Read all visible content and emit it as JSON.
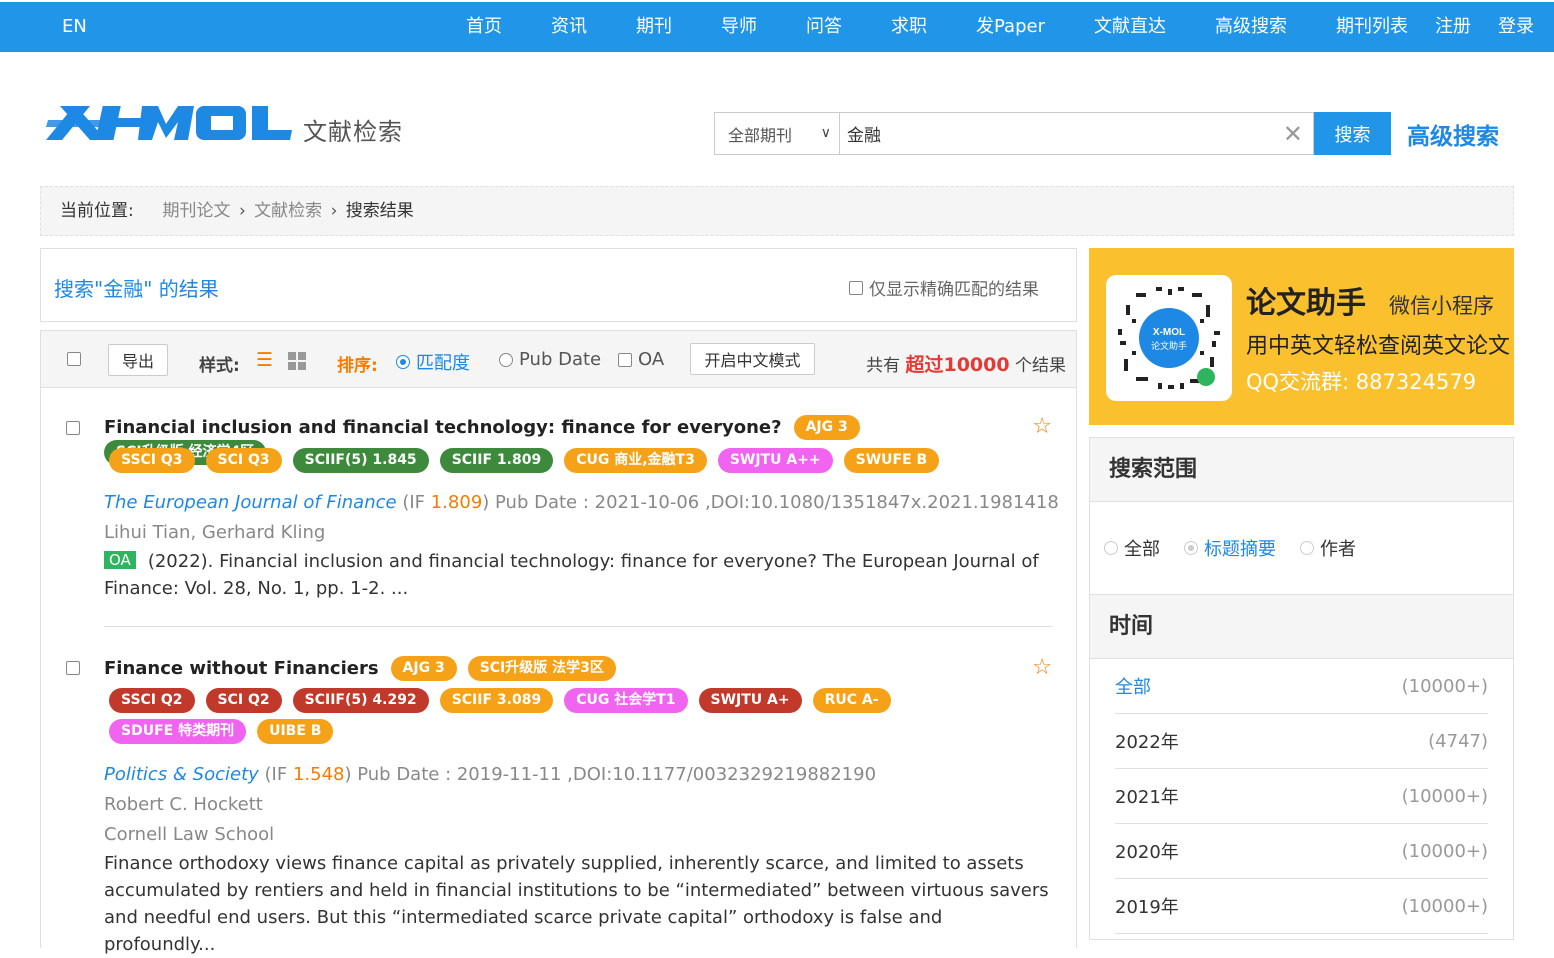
{
  "topnav": {
    "lang": "EN",
    "items": [
      "首页",
      "资讯",
      "期刊",
      "导师",
      "问答",
      "求职",
      "发Paper",
      "文献直达",
      "高级搜索",
      "期刊列表",
      "注册",
      "登录"
    ]
  },
  "header": {
    "logo_text": "X-MOL",
    "logo_sub": "文献检索",
    "scope_value": "全部期刊",
    "search_value": "金融",
    "search_btn": "搜索",
    "advanced_link": "高级搜索"
  },
  "breadcrumb": {
    "label": "当前位置:",
    "items": [
      "期刊论文",
      "文献检索",
      "搜索结果"
    ]
  },
  "results_header": {
    "title": "搜索\"金融\" 的结果",
    "exact_only": "仅显示精确匹配的结果"
  },
  "toolbar": {
    "export": "导出",
    "style_label": "样式:",
    "sort_label": "排序:",
    "sort_relevance": "匹配度",
    "sort_pubdate": "Pub Date",
    "oa": "OA",
    "cn_mode": "开启中文模式",
    "total_prefix": "共有",
    "total_value": "超过10000",
    "total_suffix": "个结果"
  },
  "results": [
    {
      "title": "Financial inclusion and financial technology: finance for everyone?",
      "inline_badges": [
        {
          "text": "AJG 3",
          "color": "orange"
        },
        {
          "text": "SCI升级版 经济学4区",
          "color": "green"
        }
      ],
      "badges": [
        {
          "text": "SSCI Q3",
          "color": "orange"
        },
        {
          "text": "SCI Q3",
          "color": "orange"
        },
        {
          "text": "SCIIF(5) 1.845",
          "color": "green"
        },
        {
          "text": "SCIIF 1.809",
          "color": "green"
        },
        {
          "text": "CUG 商业,金融T3",
          "color": "orange"
        },
        {
          "text": "SWJTU A++",
          "color": "pink"
        },
        {
          "text": "SWUFE B",
          "color": "orange"
        }
      ],
      "journal": "The European Journal of Finance",
      "if_prefix": " (IF ",
      "if_value": "1.809",
      "meta_rest": ") Pub Date : 2021-10-06 ,DOI:10.1080/1351847x.2021.1981418",
      "authors": "Lihui Tian, Gerhard Kling",
      "oa_tag": "OA",
      "abstract": "(2022). Financial inclusion and financial technology: finance for everyone? The European Journal of Finance: Vol. 28, No. 1, pp. 1-2. ..."
    },
    {
      "title": "Finance without Financiers",
      "inline_badges": [
        {
          "text": "AJG 3",
          "color": "orange"
        },
        {
          "text": "SCI升级版 法学3区",
          "color": "orange"
        }
      ],
      "badges": [
        {
          "text": "SSCI Q2",
          "color": "red"
        },
        {
          "text": "SCI Q2",
          "color": "red"
        },
        {
          "text": "SCIIF(5) 4.292",
          "color": "red"
        },
        {
          "text": "SCIIF 3.089",
          "color": "orange"
        },
        {
          "text": "CUG 社会学T1",
          "color": "pink"
        },
        {
          "text": "SWJTU A+",
          "color": "red"
        },
        {
          "text": "RUC A-",
          "color": "orange"
        },
        {
          "text": "SDUFE 特类期刊",
          "color": "pink"
        },
        {
          "text": "UIBE B",
          "color": "orange"
        }
      ],
      "journal": "Politics & Society",
      "if_prefix": " (IF ",
      "if_value": "1.548",
      "meta_rest": ") Pub Date : 2019-11-11 ,DOI:10.1177/0032329219882190",
      "authors": "Robert C. Hockett",
      "affiliation": "Cornell Law School",
      "abstract": "Finance orthodoxy views finance capital as privately supplied, inherently scarce, and limited to assets accumulated by rentiers and held in financial institutions to be “intermediated” between virtuous savers and needful end users. But this “intermediated scarce private capital” orthodoxy is false and profoundly..."
    }
  ],
  "promo": {
    "title": "论文助手",
    "title_suffix": "微信小程序",
    "line2": "用中英文轻松查阅英文论文",
    "line3": "QQ交流群: 887324579",
    "qr_label": "论文助手"
  },
  "search_scope": {
    "heading": "搜索范围",
    "options": [
      "全部",
      "标题摘要",
      "作者"
    ],
    "selected": "标题摘要"
  },
  "time_filter": {
    "heading": "时间",
    "rows": [
      {
        "label": "全部",
        "count": "(10000+)"
      },
      {
        "label": "2022年",
        "count": "(4747)"
      },
      {
        "label": "2021年",
        "count": "(10000+)"
      },
      {
        "label": "2020年",
        "count": "(10000+)"
      },
      {
        "label": "2019年",
        "count": "(10000+)"
      }
    ]
  },
  "colors": {
    "brand_blue": "#2196e8",
    "link_blue": "#1e88e5",
    "accent_orange": "#f57c00",
    "highlight_red": "#e53935",
    "badge_orange": "#f5a219",
    "badge_green": "#3e8a3d",
    "badge_pink": "#f064f0",
    "badge_red": "#c0392b",
    "promo_yellow": "#fbc02d"
  }
}
